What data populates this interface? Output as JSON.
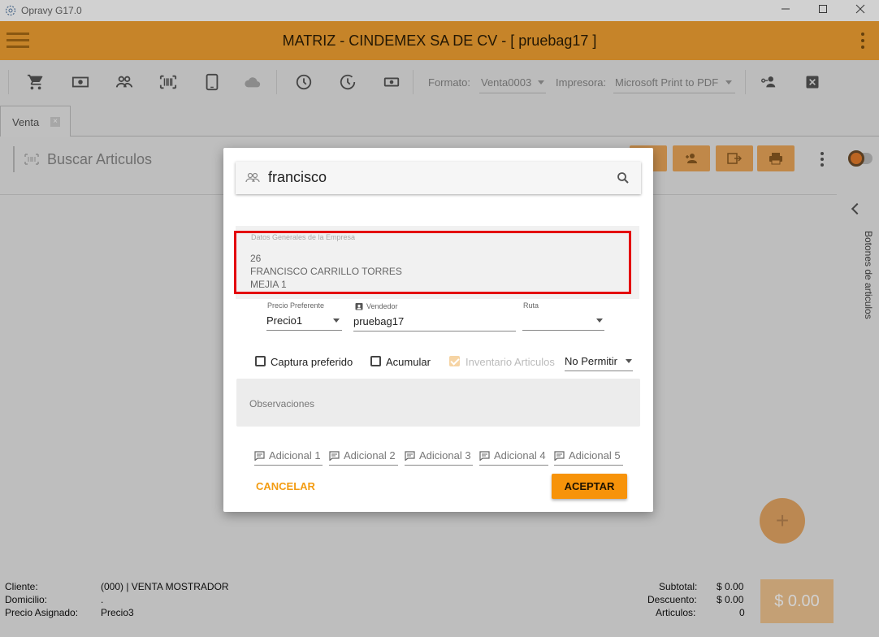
{
  "window": {
    "title": "Opravy G17.0",
    "minimize_icon": "minimize-icon",
    "maximize_icon": "maximize-icon",
    "close_icon": "close-icon"
  },
  "header": {
    "title": "MATRIZ - CINDEMEX SA DE CV - [ pruebag17 ]",
    "color": "#f2a233"
  },
  "toolbar": {
    "format_label": "Formato:",
    "format_value": "Venta0003",
    "printer_label": "Impresora:",
    "printer_value": "Microsoft Print to PDF"
  },
  "tabs": [
    {
      "label": "Venta"
    }
  ],
  "main": {
    "search_placeholder": "Buscar Articulos",
    "side_panel_label": "Botones de articulos",
    "fab_label": "+"
  },
  "footer": {
    "client_label": "Cliente:",
    "client_value": "(000) | VENTA MOSTRADOR",
    "address_label": "Domicilio:",
    "address_value": ".",
    "price_label": "Precio Asignado:",
    "price_value": "Precio3",
    "subtotal_label": "Subtotal:",
    "subtotal_value": "$ 0.00",
    "discount_label": "Descuento:",
    "discount_value": "$ 0.00",
    "articles_label": "Articulos:",
    "articles_value": "0",
    "total_button": "$ 0.00"
  },
  "dialog": {
    "customer_search_value": "francisco",
    "company": {
      "label": "Datos Generales de la Empresa",
      "id": "26",
      "name": "FRANCISCO CARRILLO TORRES",
      "address": "MEJIA 1"
    },
    "preferred_price": {
      "label": "Precio Preferente",
      "value": "Precio1"
    },
    "seller": {
      "label": "Vendedor",
      "value": "pruebag17"
    },
    "route": {
      "label": "Ruta",
      "value": ""
    },
    "checkboxes": {
      "capture_preferred": "Captura preferido",
      "accumulate": "Acumular",
      "inventory": "Inventario Articulos"
    },
    "inventory_mode": "No Permitir",
    "observations_placeholder": "Observaciones",
    "additional": [
      "Adicional 1",
      "Adicional 2",
      "Adicional 3",
      "Adicional 4",
      "Adicional 5"
    ],
    "cancel_label": "CANCELAR",
    "accept_label": "ACEPTAR",
    "accent_color": "#f7930a",
    "highlight_color": "#e4000f"
  }
}
